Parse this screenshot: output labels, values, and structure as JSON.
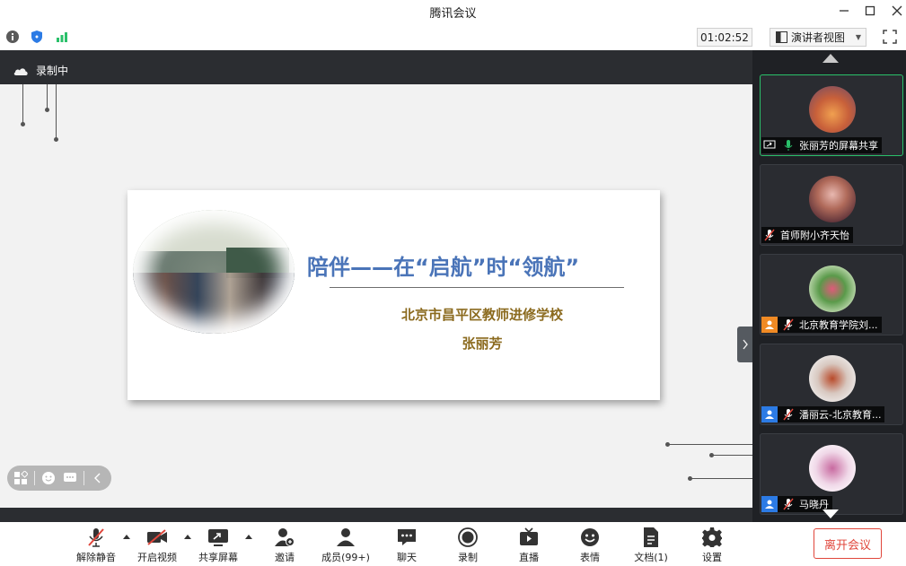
{
  "window": {
    "title": "腾讯会议",
    "minimize_icon": "minimize-icon",
    "maximize_icon": "maximize-icon",
    "close_icon": "close-icon"
  },
  "status_bar": {
    "icons": [
      "info-icon",
      "shield-icon",
      "signal-icon"
    ],
    "timer": "01:02:52",
    "view_mode": "演讲者视图",
    "fullscreen_icon": "fullscreen-icon"
  },
  "stage": {
    "recording_label": "录制中",
    "slide": {
      "headline": "陪伴——在“启航”时“领航”",
      "school": "北京市昌平区教师进修学校",
      "author": "张丽芳"
    },
    "float_tools": [
      "layout-icon",
      "emoji-icon",
      "chat-icon",
      "collapse-icon"
    ]
  },
  "participants": [
    {
      "name": "张丽芳的屏幕共享",
      "badge": "screen-share-icon",
      "mic": "mic-on",
      "active": true
    },
    {
      "name": "首师附小齐天怡",
      "badge": "",
      "mic": "mic-muted",
      "active": false
    },
    {
      "name": "北京教育学院刘...",
      "badge": "host-orange",
      "mic": "mic-muted",
      "active": false
    },
    {
      "name": "潘丽云-北京教育...",
      "badge": "user-blue",
      "mic": "mic-muted",
      "active": false
    },
    {
      "name": "马晓丹",
      "badge": "user-blue",
      "mic": "mic-muted",
      "active": false
    }
  ],
  "toolbar": {
    "unmute": "解除静音",
    "start_video": "开启视频",
    "share_screen": "共享屏幕",
    "invite": "邀请",
    "members": "成员(99+)",
    "chat": "聊天",
    "record": "录制",
    "live": "直播",
    "reactions": "表情",
    "documents": "文档(1)",
    "settings": "设置",
    "leave": "离开会议"
  },
  "colors": {
    "accent_green": "#2ac06a",
    "leave_red": "#e0463b",
    "headline_blue": "#4a74b8",
    "subtitle_gold": "#8b6a1e"
  }
}
